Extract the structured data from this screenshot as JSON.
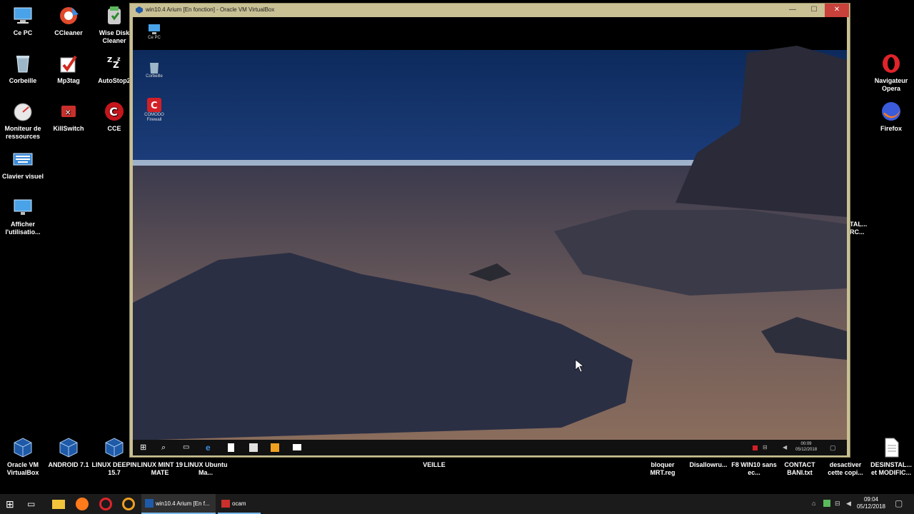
{
  "host_desktop": {
    "icons_left": [
      {
        "label": "Ce PC",
        "icon": "computer-icon"
      },
      {
        "label": "CCleaner",
        "icon": "ccleaner-icon"
      },
      {
        "label": "Wise Disk Cleaner",
        "icon": "wise-disk-cleaner-icon"
      },
      {
        "label": "Corbeille",
        "icon": "recycle-bin-icon"
      },
      {
        "label": "Mp3tag",
        "icon": "mp3tag-icon"
      },
      {
        "label": "AutoStop2",
        "icon": "autostop-icon"
      },
      {
        "label": "Moniteur de ressources",
        "icon": "resource-monitor-icon"
      },
      {
        "label": "KillSwitch",
        "icon": "killswitch-icon"
      },
      {
        "label": "CCE",
        "icon": "cce-icon"
      },
      {
        "label": "Clavier visuel",
        "icon": "keyboard-icon"
      },
      {
        "label": "Afficher l'utilisatio...",
        "icon": "display-icon"
      }
    ],
    "icons_right": [
      {
        "label": "Navigateur Opera",
        "icon": "opera-icon"
      },
      {
        "label": "Firefox",
        "icon": "firefox-icon"
      }
    ],
    "partial_right": [
      "TAL...",
      "RC..."
    ],
    "icons_bottom": [
      {
        "label": "Oracle VM VirtualBox",
        "icon": "virtualbox-icon"
      },
      {
        "label": "ANDROID 7.1",
        "icon": "virtualbox-icon"
      },
      {
        "label": "LINUX DEEPIN 15.7",
        "icon": "virtualbox-icon"
      },
      {
        "label": "LINUX MINT 19 MATE",
        "icon": ""
      },
      {
        "label": "LINUX Ubuntu Ma...",
        "icon": ""
      },
      {
        "label": "VEILLE",
        "icon": ""
      },
      {
        "label": "bloquer MRT.reg",
        "icon": ""
      },
      {
        "label": "Disallowru...",
        "icon": ""
      },
      {
        "label": "F8 WIN10 sans ec...",
        "icon": ""
      },
      {
        "label": "CONTACT BANI.txt",
        "icon": ""
      },
      {
        "label": "desactiver cette copi...",
        "icon": ""
      },
      {
        "label": "DESINSTAL... et MODIFIC...",
        "icon": "document-icon"
      }
    ]
  },
  "vm_window": {
    "title": "win10.4 Arium [En fonction] - Oracle VM VirtualBox",
    "minimize": "—",
    "maximize": "☐",
    "close": "✕",
    "guest_icons": [
      {
        "label": "Ce PC",
        "icon": "computer-icon"
      },
      {
        "label": "Corbeille",
        "icon": "recycle-bin-icon"
      },
      {
        "label": "COMODO Firewall",
        "icon": "comodo-icon"
      }
    ],
    "guest_clock": {
      "time": "00:09",
      "date": "05/12/2018"
    }
  },
  "taskbar": {
    "apps": [
      {
        "label": "win10.4 Arium [En f...",
        "icon": "virtualbox-icon"
      },
      {
        "label": "ocam",
        "icon": "ocam-icon"
      }
    ],
    "clock": {
      "time": "09:04",
      "date": "05/12/2018"
    }
  },
  "colors": {
    "vm_frame": "#c9c094",
    "close_red": "#c8413a",
    "taskbar": "#1b1b1b",
    "accent": "#76b9ed"
  }
}
